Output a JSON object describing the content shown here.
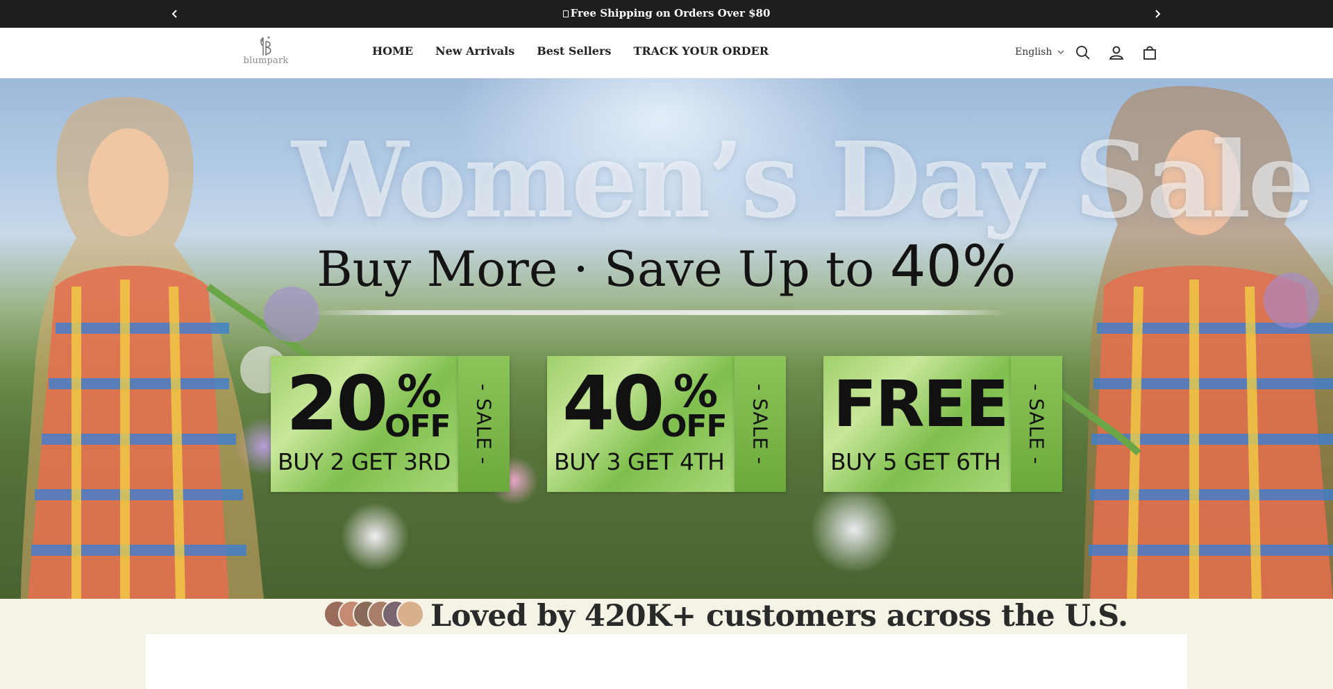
{
  "announcement": {
    "message": "Free Shipping on Orders Over $80",
    "prev_icon": "chevron-left-icon",
    "next_icon": "chevron-right-icon"
  },
  "header": {
    "logo_text": "blumpark",
    "nav": [
      {
        "label": "HOME"
      },
      {
        "label": "New Arrivals"
      },
      {
        "label": "Best Sellers"
      },
      {
        "label": "TRACK YOUR ORDER"
      }
    ],
    "language": "English",
    "icons": [
      "search-icon",
      "account-icon",
      "cart-icon"
    ]
  },
  "hero": {
    "title": "Women’s Day Sale",
    "subtitle_prefix": "Buy More · Save Up to ",
    "subtitle_percent": "40%",
    "coupons": [
      {
        "value": "20",
        "percent": "%",
        "off": "OFF",
        "deal": "BUY 2 GET 3RD",
        "tag": "- SALE -"
      },
      {
        "value": "40",
        "percent": "%",
        "off": "OFF",
        "deal": "BUY 3 GET 4TH",
        "tag": "- SALE -"
      },
      {
        "value": "FREE",
        "deal": "BUY 5 GET 6TH",
        "tag": "- SALE -"
      }
    ]
  },
  "social_proof": {
    "text": "Loved by 420K+ customers across the U.S.",
    "avatar_count": 6
  },
  "colors": {
    "announcement_bg": "#1e1e1e",
    "page_bg": "#f4f3e6",
    "coupon_green": "#9fd06a"
  }
}
